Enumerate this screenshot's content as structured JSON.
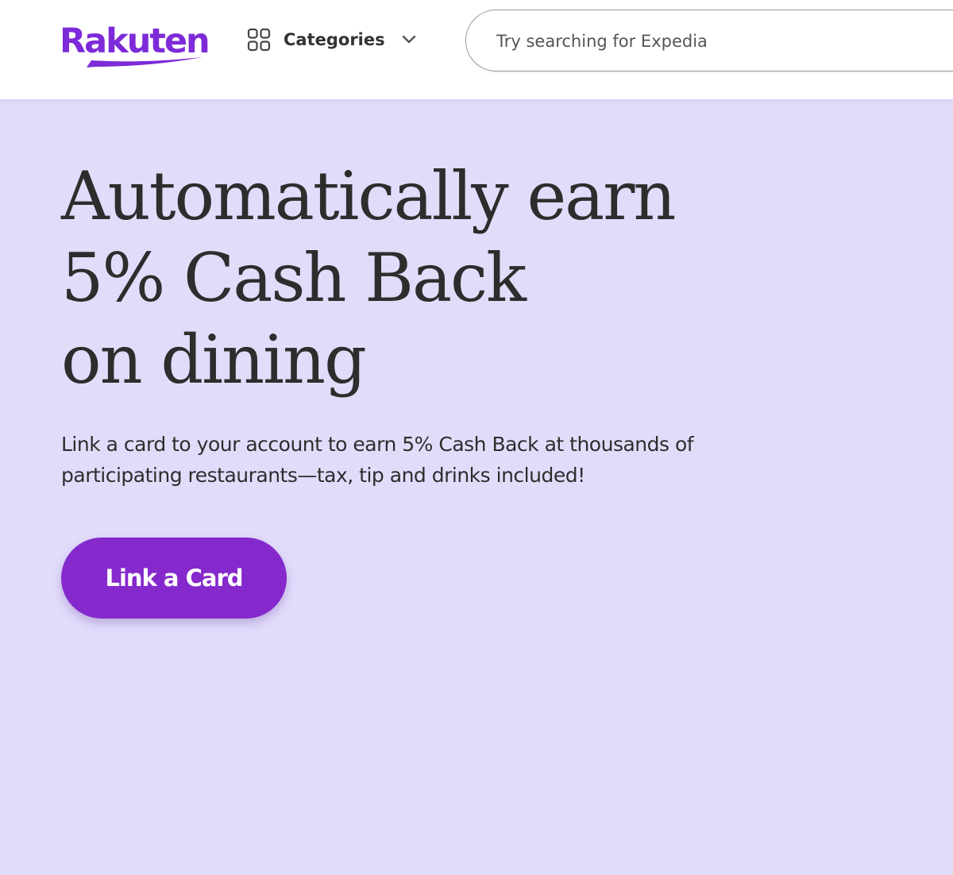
{
  "header": {
    "logo_text": "Rakuten",
    "categories_label": "Categories",
    "search_placeholder": "Try searching for Expedia"
  },
  "hero": {
    "headline_lines": [
      "Automatically earn",
      "5% Cash Back",
      "on dining"
    ],
    "subtext": "Link a card to your account to earn 5% Cash Back at thousands of participating restaurants—tax, tip and drinks included!",
    "cta_label": "Link a Card"
  },
  "colors": {
    "brand_purple": "#7d2bd8",
    "button_purple": "#8529cd",
    "hero_background": "#e2dcfb",
    "text_dark": "#2d2d2d"
  },
  "icons": {
    "categories": "grid-icon",
    "dropdown": "chevron-down-icon"
  }
}
